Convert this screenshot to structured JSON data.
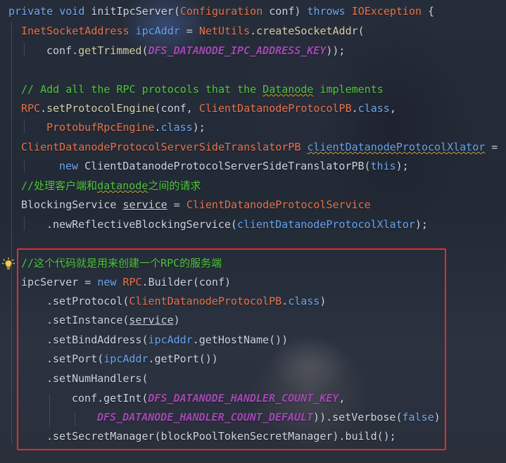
{
  "editor": {
    "theme": "dark-anime-background",
    "highlight_color": "#e12d2d",
    "bulb_icon": "lightbulb-icon",
    "lines": [
      [
        [
          "private void ",
          "kw"
        ],
        [
          "initIpcServer",
          "plain"
        ],
        [
          "(",
          "punc"
        ],
        [
          "Configuration",
          "type"
        ],
        [
          " conf) ",
          "plain"
        ],
        [
          "throws ",
          "kw"
        ],
        [
          "IOException",
          "type"
        ],
        [
          " {",
          "plain"
        ]
      ],
      [
        [
          "InetSocketAddress",
          "type"
        ],
        [
          " ",
          "plain"
        ],
        [
          "ipcAddr",
          "var"
        ],
        [
          " = ",
          "plain"
        ],
        [
          "NetUtils",
          "type"
        ],
        [
          ".",
          "punc"
        ],
        [
          "createSocketAddr",
          "method"
        ],
        [
          "(",
          "punc"
        ]
      ],
      [
        [
          "conf",
          "plain"
        ],
        [
          ".",
          "punc"
        ],
        [
          "getTrimmed",
          "method"
        ],
        [
          "(",
          "punc"
        ],
        [
          "DFS_DATANODE_IPC_ADDRESS_KEY",
          "const"
        ],
        [
          "));",
          "plain"
        ]
      ],
      [],
      [
        [
          "// Add all the RPC protocols that the ",
          "cm"
        ],
        [
          "Datanode",
          "cm squig"
        ],
        [
          " implements",
          "cm"
        ]
      ],
      [
        [
          "RPC",
          "type"
        ],
        [
          ".",
          "punc"
        ],
        [
          "setProtocolEngine",
          "method"
        ],
        [
          "(conf, ",
          "plain"
        ],
        [
          "ClientDatanodeProtocolPB",
          "type"
        ],
        [
          ".",
          "punc"
        ],
        [
          "class",
          "kw"
        ],
        [
          ",",
          "plain"
        ]
      ],
      [
        [
          "ProtobufRpcEngine",
          "type"
        ],
        [
          ".",
          "punc"
        ],
        [
          "class",
          "kw"
        ],
        [
          ");",
          "plain"
        ]
      ],
      [
        [
          "ClientDatanodeProtocolServerSideTranslatorPB",
          "type"
        ],
        [
          " ",
          "plain"
        ],
        [
          "clientDatanodeProtocolXlator",
          "var squig"
        ],
        [
          " =",
          "plain"
        ]
      ],
      [
        [
          "new ",
          "kw"
        ],
        [
          "ClientDatanodeProtocolServerSideTranslatorPB",
          "plain"
        ],
        [
          "(",
          "punc"
        ],
        [
          "this",
          "kw"
        ],
        [
          ");",
          "plain"
        ]
      ],
      [
        [
          "//处理客户端和",
          "cm"
        ],
        [
          "datanode",
          "cm squig"
        ],
        [
          "之间的请求",
          "cm"
        ]
      ],
      [
        [
          "BlockingService",
          "plain"
        ],
        [
          " ",
          "plain"
        ],
        [
          "service",
          "plain under"
        ],
        [
          " = ",
          "plain"
        ],
        [
          "ClientDatanodeProtocolService",
          "type"
        ]
      ],
      [
        [
          ".",
          "punc"
        ],
        [
          "newReflectiveBlockingService",
          "plain"
        ],
        [
          "(",
          "punc"
        ],
        [
          "clientDatanodeProtocolXlator",
          "var"
        ],
        [
          ");",
          "plain"
        ]
      ],
      [],
      [
        [
          "//这个代码就是用来创建一个RPC的服务端",
          "cm"
        ]
      ],
      [
        [
          "ipcServer",
          "plain"
        ],
        [
          " = ",
          "plain"
        ],
        [
          "new ",
          "kw"
        ],
        [
          "RPC",
          "type"
        ],
        [
          ".",
          "punc"
        ],
        [
          "Builder",
          "plain"
        ],
        [
          "(conf)",
          "plain"
        ]
      ],
      [
        [
          ".",
          "punc"
        ],
        [
          "setProtocol",
          "plain"
        ],
        [
          "(",
          "punc"
        ],
        [
          "ClientDatanodeProtocolPB",
          "type"
        ],
        [
          ".",
          "punc"
        ],
        [
          "class",
          "kw"
        ],
        [
          ")",
          "plain"
        ]
      ],
      [
        [
          ".",
          "punc"
        ],
        [
          "setInstance",
          "plain"
        ],
        [
          "(",
          "punc"
        ],
        [
          "service",
          "plain under"
        ],
        [
          ")",
          "plain"
        ]
      ],
      [
        [
          ".",
          "punc"
        ],
        [
          "setBindAddress",
          "plain"
        ],
        [
          "(",
          "punc"
        ],
        [
          "ipcAddr",
          "var"
        ],
        [
          ".",
          "punc"
        ],
        [
          "getHostName",
          "plain"
        ],
        [
          "())",
          "plain"
        ]
      ],
      [
        [
          ".",
          "punc"
        ],
        [
          "setPort",
          "plain"
        ],
        [
          "(",
          "punc"
        ],
        [
          "ipcAddr",
          "var"
        ],
        [
          ".",
          "punc"
        ],
        [
          "getPort",
          "plain"
        ],
        [
          "())",
          "plain"
        ]
      ],
      [
        [
          ".",
          "punc"
        ],
        [
          "setNumHandlers",
          "plain"
        ],
        [
          "(",
          "punc"
        ]
      ],
      [
        [
          "conf",
          "plain"
        ],
        [
          ".",
          "punc"
        ],
        [
          "getInt",
          "plain"
        ],
        [
          "(",
          "punc"
        ],
        [
          "DFS_DATANODE_HANDLER_COUNT_KEY",
          "const"
        ],
        [
          ",",
          "plain"
        ]
      ],
      [
        [
          "DFS_DATANODE_HANDLER_COUNT_DEFAULT",
          "const"
        ],
        [
          ")).",
          "plain"
        ],
        [
          "setVerbose",
          "plain"
        ],
        [
          "(",
          "punc"
        ],
        [
          "false",
          "kw"
        ],
        [
          ")",
          "plain"
        ]
      ],
      [
        [
          ".",
          "punc"
        ],
        [
          "setSecretManager",
          "plain"
        ],
        [
          "(blockPoolTokenSecretManager).",
          "plain"
        ],
        [
          "build",
          "plain"
        ],
        [
          "();",
          "plain"
        ]
      ]
    ]
  }
}
